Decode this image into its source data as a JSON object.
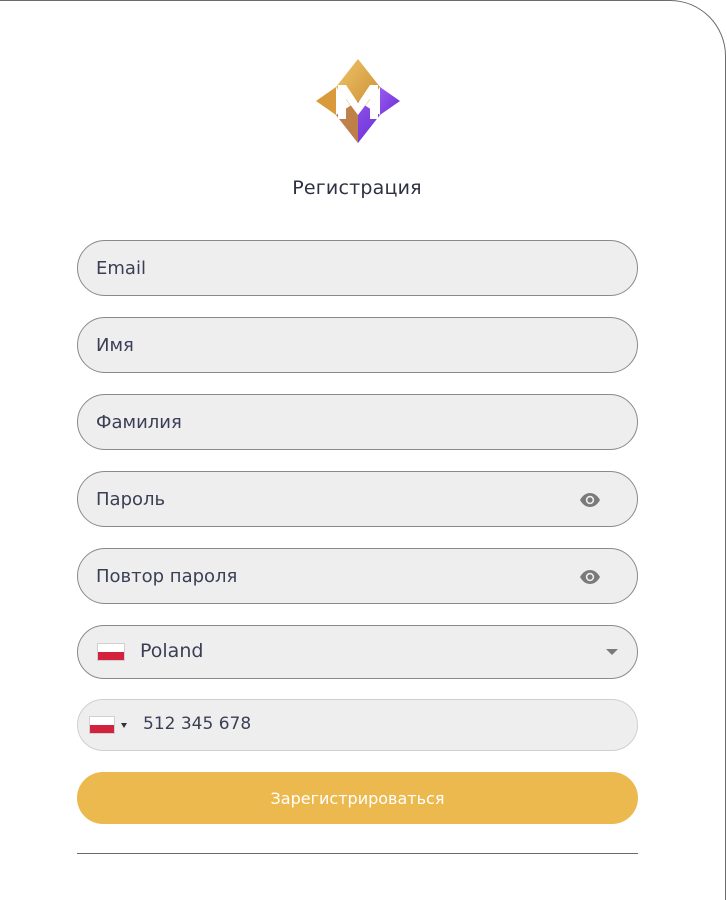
{
  "form": {
    "title": "Регистрация",
    "fields": {
      "email": "Email",
      "first_name": "Имя",
      "last_name": "Фамилия",
      "password": "Пароль",
      "password_repeat": "Повтор пароля"
    },
    "country": {
      "selected": "Poland",
      "flag": "poland-flag"
    },
    "phone": {
      "placeholder": "512 345 678",
      "flag": "poland-flag"
    },
    "submit_label": "Зарегистрироваться"
  },
  "colors": {
    "accent": "#ecb94f",
    "field_bg": "#efeeef",
    "text": "#3b3f55",
    "logo_gold": "#e0a84a",
    "logo_purple": "#7b3fe4"
  },
  "icons": {
    "password_toggle": "eye-icon",
    "dropdown": "chevron-down-icon"
  }
}
